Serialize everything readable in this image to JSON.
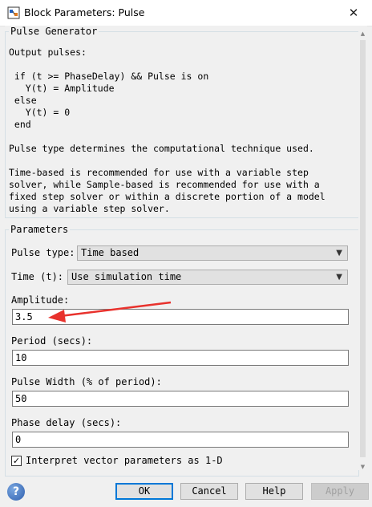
{
  "window": {
    "title": "Block Parameters: Pulse",
    "close_glyph": "✕"
  },
  "description": {
    "legend": "Pulse Generator",
    "text": "Output pulses:\n\n if (t >= PhaseDelay) && Pulse is on\n   Y(t) = Amplitude\n else\n   Y(t) = 0\n end\n\nPulse type determines the computational technique used.\n\nTime-based is recommended for use with a variable step\nsolver, while Sample-based is recommended for use with a\nfixed step solver or within a discrete portion of a model\nusing a variable step solver."
  },
  "parameters": {
    "legend": "Parameters",
    "pulse_type": {
      "label": "Pulse type:",
      "value": "Time based"
    },
    "time": {
      "label": "Time (t):",
      "value": "Use simulation time"
    },
    "amplitude": {
      "label": "Amplitude:",
      "value": "3.5"
    },
    "period": {
      "label": "Period (secs):",
      "value": "10"
    },
    "pulse_width": {
      "label": "Pulse Width (% of period):",
      "value": "50"
    },
    "phase_delay": {
      "label": "Phase delay (secs):",
      "value": "0"
    },
    "interpret_vector": {
      "label": "Interpret vector parameters as 1-D",
      "checked": true,
      "glyph": "✓"
    }
  },
  "buttons": {
    "help_glyph": "?",
    "ok": "OK",
    "cancel": "Cancel",
    "help": "Help",
    "apply": "Apply"
  },
  "glyphs": {
    "dropdown": "▼",
    "scroll_up": "▲",
    "scroll_down": "▼"
  },
  "colors": {
    "annotation_arrow": "#e8322d",
    "ok_focus": "#0078d7"
  }
}
